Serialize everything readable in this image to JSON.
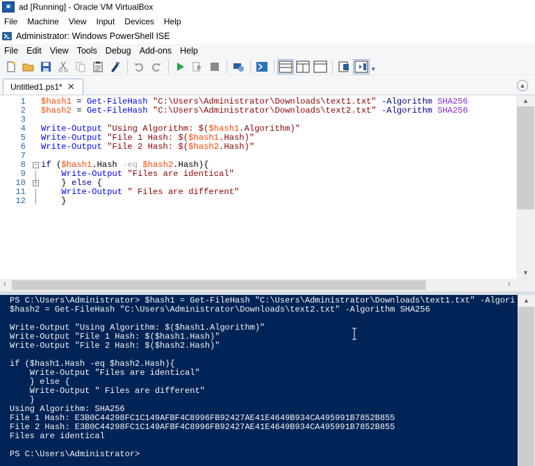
{
  "vbox": {
    "title": "ad [Running] - Oracle VM VirtualBox",
    "menu": [
      "File",
      "Machine",
      "View",
      "Input",
      "Devices",
      "Help"
    ]
  },
  "ise": {
    "title": "Administrator: Windows PowerShell ISE",
    "menu": [
      "File",
      "Edit",
      "View",
      "Tools",
      "Debug",
      "Add-ons",
      "Help"
    ],
    "toolbar": [
      "new-icon",
      "open-icon",
      "save-icon",
      "cut-icon",
      "copy-icon",
      "paste-icon",
      "clear-icon",
      "undo-icon",
      "redo-icon",
      "run-icon",
      "run-selection-icon",
      "stop-icon",
      "remote-tab-icon",
      "powershell-icon",
      "layout-top-icon",
      "layout-right-icon",
      "layout-max-icon",
      "commands-icon",
      "addon-icon"
    ]
  },
  "tab": {
    "label": "Untitled1.ps1*",
    "close": "✕"
  },
  "editor": {
    "line_numbers": [
      "1",
      "2",
      "3",
      "4",
      "5",
      "6",
      "7",
      "8",
      "9",
      "10",
      "11",
      "12"
    ],
    "lines": [
      [
        {
          "c": "var",
          "t": "$hash1"
        },
        {
          "c": "pun",
          "t": " = "
        },
        {
          "c": "cmd",
          "t": "Get-FileHash"
        },
        {
          "c": "pun",
          "t": " "
        },
        {
          "c": "str",
          "t": "\"C:\\Users\\Administrator\\Downloads\\text1.txt\""
        },
        {
          "c": "pun",
          "t": " "
        },
        {
          "c": "par",
          "t": "-Algorithm"
        },
        {
          "c": "pun",
          "t": " "
        },
        {
          "c": "val",
          "t": "SHA256"
        }
      ],
      [
        {
          "c": "var",
          "t": "$hash2"
        },
        {
          "c": "pun",
          "t": " = "
        },
        {
          "c": "cmd",
          "t": "Get-FileHash"
        },
        {
          "c": "pun",
          "t": " "
        },
        {
          "c": "str",
          "t": "\"C:\\Users\\Administrator\\Downloads\\text2.txt\""
        },
        {
          "c": "pun",
          "t": " "
        },
        {
          "c": "par",
          "t": "-Algorithm"
        },
        {
          "c": "pun",
          "t": " "
        },
        {
          "c": "val",
          "t": "SHA256"
        }
      ],
      [],
      [
        {
          "c": "cmd",
          "t": "Write-Output"
        },
        {
          "c": "pun",
          "t": " "
        },
        {
          "c": "str",
          "t": "\"Using Algorithm: $("
        },
        {
          "c": "var",
          "t": "$hash1"
        },
        {
          "c": "str",
          "t": ".Algorithm)\""
        }
      ],
      [
        {
          "c": "cmd",
          "t": "Write-Output"
        },
        {
          "c": "pun",
          "t": " "
        },
        {
          "c": "str",
          "t": "\"File 1 Hash: $("
        },
        {
          "c": "var",
          "t": "$hash1"
        },
        {
          "c": "str",
          "t": ".Hash)\""
        }
      ],
      [
        {
          "c": "cmd",
          "t": "Write-Output"
        },
        {
          "c": "pun",
          "t": " "
        },
        {
          "c": "str",
          "t": "\"File 2 Hash: $("
        },
        {
          "c": "var",
          "t": "$hash2"
        },
        {
          "c": "str",
          "t": ".Hash)\""
        }
      ],
      [],
      [
        {
          "c": "kw",
          "t": "if"
        },
        {
          "c": "pun",
          "t": " ("
        },
        {
          "c": "var",
          "t": "$hash1"
        },
        {
          "c": "pun",
          "t": ".Hash "
        },
        {
          "c": "op",
          "t": "-eq"
        },
        {
          "c": "pun",
          "t": " "
        },
        {
          "c": "var",
          "t": "$hash2"
        },
        {
          "c": "pun",
          "t": ".Hash){"
        }
      ],
      [
        {
          "c": "pun",
          "t": "    "
        },
        {
          "c": "cmd",
          "t": "Write-Output"
        },
        {
          "c": "pun",
          "t": " "
        },
        {
          "c": "str",
          "t": "\"Files are identical\""
        }
      ],
      [
        {
          "c": "pun",
          "t": "    } "
        },
        {
          "c": "kw",
          "t": "else"
        },
        {
          "c": "pun",
          "t": " {"
        }
      ],
      [
        {
          "c": "pun",
          "t": "    "
        },
        {
          "c": "cmd",
          "t": "Write-Output"
        },
        {
          "c": "pun",
          "t": " "
        },
        {
          "c": "str",
          "t": "\" Files are different\""
        }
      ],
      [
        {
          "c": "pun",
          "t": "    }"
        }
      ]
    ]
  },
  "console": {
    "lines": [
      "PS C:\\Users\\Administrator> $hash1 = Get-FileHash \"C:\\Users\\Administrator\\Downloads\\text1.txt\" -Algori",
      "$hash2 = Get-FileHash \"C:\\Users\\Administrator\\Downloads\\text2.txt\" -Algorithm SHA256",
      "",
      "Write-Output \"Using Algorithm: $($hash1.Algorithm)\"",
      "Write-Output \"File 1 Hash: $($hash1.Hash)\"",
      "Write-Output \"File 2 Hash: $($hash2.Hash)\"",
      "",
      "if ($hash1.Hash -eq $hash2.Hash){",
      "    Write-Output \"Files are identical\"",
      "    } else {",
      "    Write-Output \" Files are different\"",
      "    }",
      "Using Algorithm: SHA256",
      "File 1 Hash: E3B0C44298FC1C149AFBF4C8996FB92427AE41E4649B934CA495991B7852B855",
      "File 2 Hash: E3B0C44298FC1C149AFBF4C8996FB92427AE41E4649B934CA495991B7852B855",
      "Files are identical",
      "",
      "PS C:\\Users\\Administrator>"
    ]
  }
}
